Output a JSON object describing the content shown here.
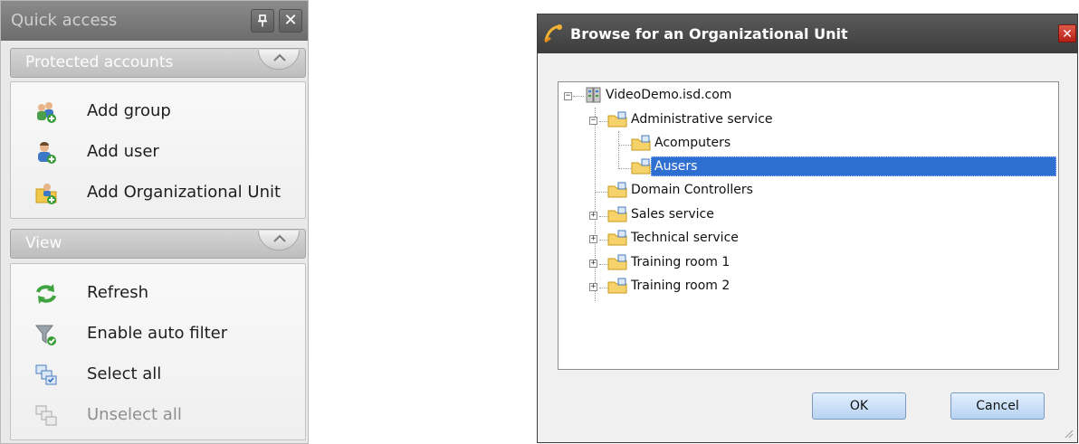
{
  "quick_access": {
    "title": "Quick access",
    "pin_label": "Ԉ",
    "close_label": "✕",
    "sections": [
      {
        "title": "Protected accounts",
        "items": [
          {
            "label": "Add group",
            "icon": "add-group-icon"
          },
          {
            "label": "Add user",
            "icon": "add-user-icon"
          },
          {
            "label": "Add Organizational Unit",
            "icon": "add-ou-icon"
          }
        ]
      },
      {
        "title": "View",
        "items": [
          {
            "label": "Refresh",
            "icon": "refresh-icon"
          },
          {
            "label": "Enable auto filter",
            "icon": "filter-icon"
          },
          {
            "label": "Select all",
            "icon": "select-all-icon"
          },
          {
            "label": "Unselect all",
            "icon": "unselect-all-icon",
            "disabled": true
          }
        ]
      }
    ]
  },
  "dialog": {
    "title": "Browse for an Organizational Unit",
    "close_label": "✕",
    "tree": {
      "root": "VideoDemo.isd.com",
      "nodes": [
        {
          "label": "Administrative service",
          "expanded": true
        },
        {
          "label": "Acomputers"
        },
        {
          "label": "Ausers",
          "selected": true
        },
        {
          "label": "Domain Controllers"
        },
        {
          "label": "Sales service",
          "expandable": true
        },
        {
          "label": "Technical service",
          "expandable": true
        },
        {
          "label": "Training room 1",
          "expandable": true
        },
        {
          "label": "Training room 2",
          "expandable": true
        }
      ]
    },
    "ok_label": "OK",
    "cancel_label": "Cancel"
  },
  "colors": {
    "selection": "#2f6fd1",
    "dialog_title_bar": "#3c3c3c",
    "close_button": "#b51f14",
    "button_face": "#b7d3f2"
  }
}
